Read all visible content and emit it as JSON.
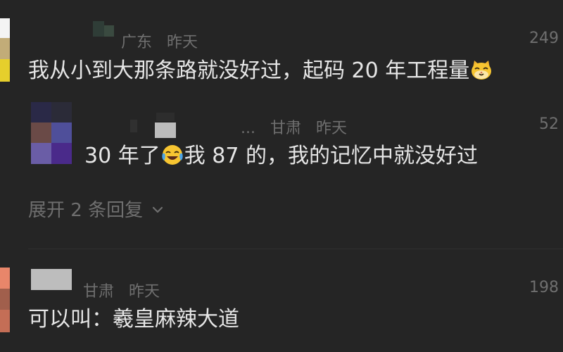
{
  "comments": [
    {
      "location": "广东",
      "time": "昨天",
      "likes": "249",
      "text": "我从小到大那条路就没好过，起码 20 年工程量",
      "trailing_emoji": "cat-face-emoji",
      "avatar_colors": [
        "#f4f4f4",
        "#c2ac78",
        "#e6cf2c"
      ]
    },
    {
      "name_suffix": "...",
      "location": "甘肃",
      "time": "昨天",
      "likes": "52",
      "text_before": "30 年了",
      "inline_emoji": "crying-laughing-emoji",
      "text_after": "我 87 的，我的记忆中就没好过",
      "avatar_colors": [
        "#2a2947",
        "#2b2b38",
        "#6a4a47",
        "#4f4f9a",
        "#6a5da6",
        "#4a2a8a"
      ]
    },
    {
      "location": "甘肃",
      "time": "昨天",
      "likes": "198",
      "text": "可以叫：羲皇麻辣大道",
      "avatar_colors": [
        "#e8866a",
        "#a15f4c",
        "#c46e56"
      ]
    }
  ],
  "expand_replies": {
    "label": "展开 2 条回复",
    "icon": "chevron-down-icon"
  },
  "colors": {
    "background": "#252525",
    "primary_text": "#e6e6e6",
    "secondary_text": "#6f6f6f"
  }
}
